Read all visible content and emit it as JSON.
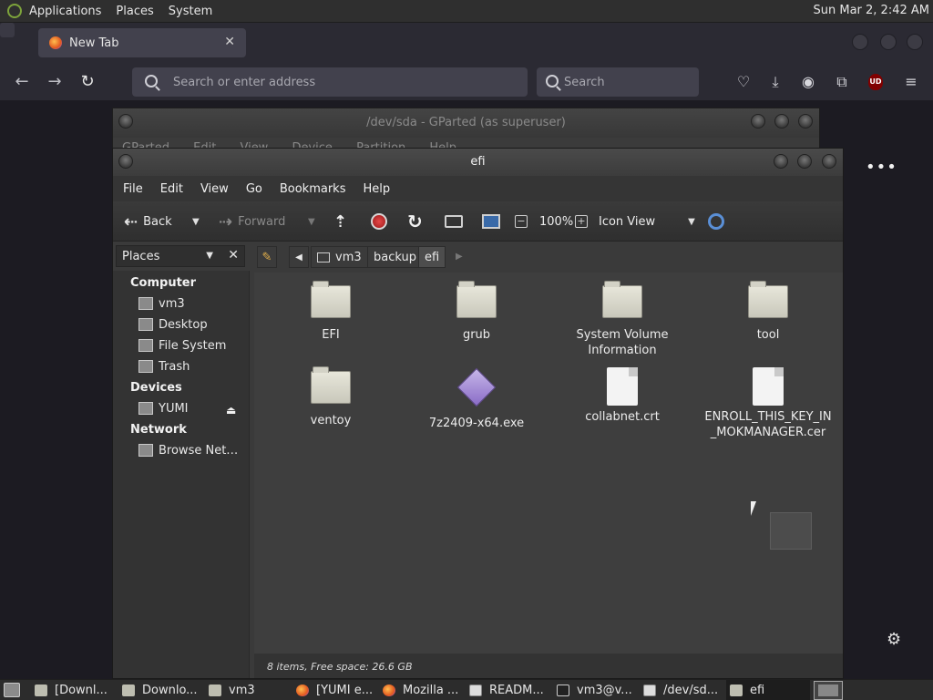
{
  "top_panel": {
    "menus": [
      "Applications",
      "Places",
      "System"
    ],
    "clock": "Sun Mar  2,  2:42 AM"
  },
  "firefox": {
    "tab_title": "New Tab",
    "tab_close": "✕",
    "url_placeholder": "Search or enter address",
    "search_placeholder": "Search",
    "ublock_label": "UD",
    "kebab": "•••",
    "gear": "⚙"
  },
  "gparted": {
    "title": "/dev/sda - GParted (as superuser)",
    "menus": [
      "GParted",
      "Edit",
      "View",
      "Device",
      "Partition",
      "Help"
    ]
  },
  "caja": {
    "title": "efi",
    "menus": [
      "File",
      "Edit",
      "View",
      "Go",
      "Bookmarks",
      "Help"
    ],
    "toolbar": {
      "back": "Back",
      "forward": "Forward",
      "zoom": "100%",
      "view": "Icon View"
    },
    "sidepanel": {
      "title": "Places",
      "sections": [
        {
          "header": "Computer",
          "items": [
            "vm3",
            "Desktop",
            "File System",
            "Trash"
          ]
        },
        {
          "header": "Devices",
          "items": [
            "YUMI"
          ]
        },
        {
          "header": "Network",
          "items": [
            "Browse Net…"
          ]
        }
      ]
    },
    "pathbar": [
      "vm3",
      "backup",
      "efi"
    ],
    "files": [
      {
        "name": "EFI",
        "icon": "folder-icon"
      },
      {
        "name": "grub",
        "icon": "folder-icon"
      },
      {
        "name": "System Volume Information",
        "icon": "folder-icon"
      },
      {
        "name": "tool",
        "icon": "folder-icon"
      },
      {
        "name": "ventoy",
        "icon": "folder-icon"
      },
      {
        "name": "7z2409-x64.exe",
        "icon": "executable-icon"
      },
      {
        "name": "collabnet.crt",
        "icon": "document-icon"
      },
      {
        "name": "ENROLL_THIS_KEY_IN_MOKMANAGER.cer",
        "icon": "document-icon"
      }
    ],
    "status": "8 items, Free space: 26.6 GB"
  },
  "taskbar": {
    "items": [
      {
        "label": "[Downl...",
        "icon": "folder"
      },
      {
        "label": "Downlo...",
        "icon": "folder"
      },
      {
        "label": "vm3",
        "icon": "folder"
      },
      {
        "label": "[YUMI e...",
        "icon": "app"
      },
      {
        "label": "Mozilla ...",
        "icon": "firefox"
      },
      {
        "label": "READM...",
        "icon": "editor"
      },
      {
        "label": "vm3@v...",
        "icon": "terminal"
      },
      {
        "label": "/dev/sd...",
        "icon": "gparted"
      },
      {
        "label": "efi",
        "icon": "folder"
      }
    ]
  }
}
